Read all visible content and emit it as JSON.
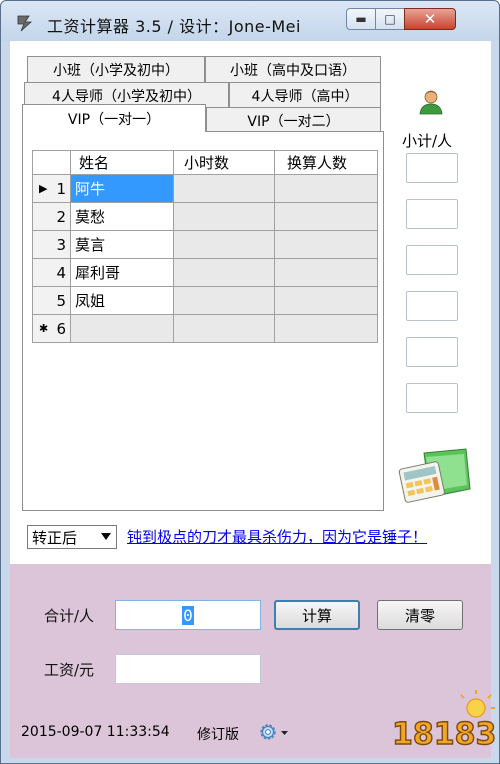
{
  "window": {
    "title": "工资计算器 3.5 /  设计：Jone-Mei",
    "min_label": "▬",
    "max_label": "□",
    "close_label": "✕"
  },
  "tabs": {
    "row1": [
      "小班（小学及初中）",
      "小班（高中及口语）"
    ],
    "row2": [
      "4人导师（小学及初中）",
      "4人导师（高中）"
    ],
    "row3": [
      "VIP（一对一）",
      "VIP（一对二）"
    ],
    "active": "VIP（一对一）"
  },
  "grid": {
    "headers": [
      "姓名",
      "小时数",
      "换算人数"
    ],
    "rows": [
      {
        "idx": "1",
        "name": "阿牛",
        "hours": "",
        "converted": "",
        "marker": "▶"
      },
      {
        "idx": "2",
        "name": "莫愁",
        "hours": "",
        "converted": "",
        "marker": ""
      },
      {
        "idx": "3",
        "name": "莫言",
        "hours": "",
        "converted": "",
        "marker": ""
      },
      {
        "idx": "4",
        "name": "犀利哥",
        "hours": "",
        "converted": "",
        "marker": ""
      },
      {
        "idx": "5",
        "name": "凤姐",
        "hours": "",
        "converted": "",
        "marker": ""
      },
      {
        "idx": "6",
        "name": "",
        "hours": "",
        "converted": "",
        "marker": "✱"
      }
    ]
  },
  "side": {
    "label": "小计/人",
    "icons": [
      "person-icon",
      "calculator-icon"
    ]
  },
  "controls": {
    "mode_select": "转正后",
    "slogan_link": "钝到极点的刀才最具杀伤力，因为它是锤子！"
  },
  "form": {
    "total_label": "合计/人",
    "total_value": "0",
    "salary_label": "工资/元",
    "salary_value": "",
    "calc_button": "计算",
    "clear_button": "清零"
  },
  "status": {
    "datetime": "2015-09-07 11:33:54",
    "revision": "修订版",
    "settings_icon": "gear-icon"
  },
  "watermark": {
    "text": "18183"
  },
  "colors": {
    "selection": "#3399ff",
    "lower_panel": "#dcc5d9",
    "link": "#0000ee"
  }
}
